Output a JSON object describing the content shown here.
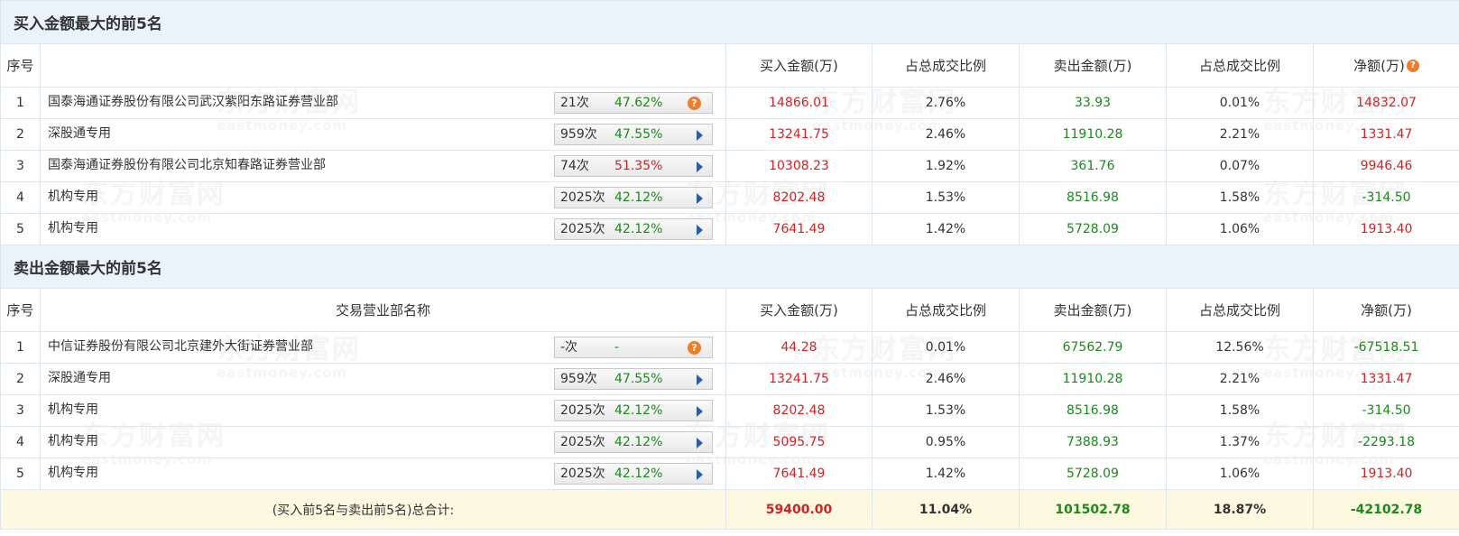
{
  "buy_section": {
    "title": "买入金额最大的前5名",
    "headers": {
      "idx": "序号",
      "name": "",
      "buy": "买入金额(万)",
      "buy_pct": "占总成交比例",
      "sell": "卖出金额(万)",
      "sell_pct": "占总成交比例",
      "net": "净额(万)"
    },
    "rows": [
      {
        "idx": "1",
        "name": "国泰海通证券股份有限公司武汉紫阳东路证券营业部",
        "times": "21次",
        "rate": "47.62%",
        "rate_color": "green",
        "icon": "question-icon",
        "buy": "14866.01",
        "buy_pct": "2.76%",
        "sell": "33.93",
        "sell_pct": "0.01%",
        "net": "14832.07",
        "net_color": "red"
      },
      {
        "idx": "2",
        "name": "深股通专用",
        "times": "959次",
        "rate": "47.55%",
        "rate_color": "green",
        "icon": "arrow-icon",
        "buy": "13241.75",
        "buy_pct": "2.46%",
        "sell": "11910.28",
        "sell_pct": "2.21%",
        "net": "1331.47",
        "net_color": "red"
      },
      {
        "idx": "3",
        "name": "国泰海通证券股份有限公司北京知春路证券营业部",
        "times": "74次",
        "rate": "51.35%",
        "rate_color": "red",
        "icon": "arrow-icon",
        "buy": "10308.23",
        "buy_pct": "1.92%",
        "sell": "361.76",
        "sell_pct": "0.07%",
        "net": "9946.46",
        "net_color": "red"
      },
      {
        "idx": "4",
        "name": "机构专用",
        "times": "2025次",
        "rate": "42.12%",
        "rate_color": "green",
        "icon": "arrow-icon",
        "buy": "8202.48",
        "buy_pct": "1.53%",
        "sell": "8516.98",
        "sell_pct": "1.58%",
        "net": "-314.50",
        "net_color": "green"
      },
      {
        "idx": "5",
        "name": "机构专用",
        "times": "2025次",
        "rate": "42.12%",
        "rate_color": "green",
        "icon": "arrow-icon",
        "buy": "7641.49",
        "buy_pct": "1.42%",
        "sell": "5728.09",
        "sell_pct": "1.06%",
        "net": "1913.40",
        "net_color": "red"
      }
    ]
  },
  "sell_section": {
    "title": "卖出金额最大的前5名",
    "headers": {
      "idx": "序号",
      "name": "交易营业部名称",
      "buy": "买入金额(万)",
      "buy_pct": "占总成交比例",
      "sell": "卖出金额(万)",
      "sell_pct": "占总成交比例",
      "net": "净额(万)"
    },
    "rows": [
      {
        "idx": "1",
        "name": "中信证券股份有限公司北京建外大街证券营业部",
        "times": "-次",
        "rate": "-",
        "rate_color": "black",
        "icon": "question-icon",
        "buy": "44.28",
        "buy_pct": "0.01%",
        "sell": "67562.79",
        "sell_pct": "12.56%",
        "net": "-67518.51",
        "net_color": "green"
      },
      {
        "idx": "2",
        "name": "深股通专用",
        "times": "959次",
        "rate": "47.55%",
        "rate_color": "green",
        "icon": "arrow-icon",
        "buy": "13241.75",
        "buy_pct": "2.46%",
        "sell": "11910.28",
        "sell_pct": "2.21%",
        "net": "1331.47",
        "net_color": "red"
      },
      {
        "idx": "3",
        "name": "机构专用",
        "times": "2025次",
        "rate": "42.12%",
        "rate_color": "green",
        "icon": "arrow-icon",
        "buy": "8202.48",
        "buy_pct": "1.53%",
        "sell": "8516.98",
        "sell_pct": "1.58%",
        "net": "-314.50",
        "net_color": "green"
      },
      {
        "idx": "4",
        "name": "机构专用",
        "times": "2025次",
        "rate": "42.12%",
        "rate_color": "green",
        "icon": "arrow-icon",
        "buy": "5095.75",
        "buy_pct": "0.95%",
        "sell": "7388.93",
        "sell_pct": "1.37%",
        "net": "-2293.18",
        "net_color": "green"
      },
      {
        "idx": "5",
        "name": "机构专用",
        "times": "2025次",
        "rate": "42.12%",
        "rate_color": "green",
        "icon": "arrow-icon",
        "buy": "7641.49",
        "buy_pct": "1.42%",
        "sell": "5728.09",
        "sell_pct": "1.06%",
        "net": "1913.40",
        "net_color": "red"
      }
    ]
  },
  "totals": {
    "label": "(买入前5名与卖出前5名)总合计:",
    "buy": "59400.00",
    "buy_pct": "11.04%",
    "sell": "101502.78",
    "sell_pct": "18.87%",
    "net": "-42102.78"
  },
  "watermark": {
    "cn": "东方财富网",
    "en": "eastmoney.com"
  },
  "colors": {
    "red": "#d22222",
    "green": "#1a8a1a",
    "header_bg": "#eaf3fb",
    "total_bg": "#fdf8e0",
    "question_icon": "#f07c2a",
    "arrow_icon": "#2a5fa8"
  }
}
